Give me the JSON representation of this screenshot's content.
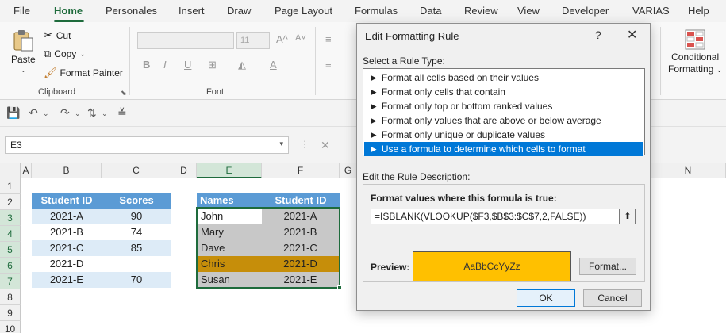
{
  "tabs": [
    "File",
    "Home",
    "Personales",
    "Insert",
    "Draw",
    "Page Layout",
    "Formulas",
    "Data",
    "Review",
    "View",
    "Developer",
    "VARIAS",
    "Help"
  ],
  "ribbon": {
    "paste": "Paste",
    "cut": "Cut",
    "copy": "Copy",
    "format_painter": "Format Painter",
    "clipboard": "Clipboard",
    "font_size": "11",
    "font": "Font",
    "bold": "B",
    "italic": "I",
    "underline": "U",
    "cond_format_1": "Conditional",
    "cond_format_2": "Formatting"
  },
  "formula_bar": {
    "name_box": "E3"
  },
  "columns": [
    "A",
    "B",
    "C",
    "D",
    "E",
    "F",
    "G",
    "N"
  ],
  "rows": [
    "1",
    "2",
    "3",
    "4",
    "5",
    "6",
    "7",
    "8",
    "9",
    "10"
  ],
  "table1": {
    "headers": [
      "Student ID",
      "Scores"
    ],
    "rows": [
      [
        "2021-A",
        "90"
      ],
      [
        "2021-B",
        "74"
      ],
      [
        "2021-C",
        "85"
      ],
      [
        "2021-D",
        ""
      ],
      [
        "2021-E",
        "70"
      ]
    ]
  },
  "table2": {
    "headers": [
      "Names",
      "Student ID"
    ],
    "rows": [
      [
        "John",
        "2021-A"
      ],
      [
        "Mary",
        "2021-B"
      ],
      [
        "Dave",
        "2021-C"
      ],
      [
        "Chris",
        "2021-D"
      ],
      [
        "Susan",
        "2021-E"
      ]
    ]
  },
  "dialog": {
    "title": "Edit Formatting Rule",
    "help": "?",
    "close": "✕",
    "select_rule_type": "Select a Rule Type:",
    "rules": [
      "Format all cells based on their values",
      "Format only cells that contain",
      "Format only top or bottom ranked values",
      "Format only values that are above or below average",
      "Format only unique or duplicate values",
      "Use a formula to determine which cells to format"
    ],
    "selected_rule": 5,
    "edit_description": "Edit the Rule Description:",
    "formula_label": "Format values where this formula is true:",
    "formula": "=ISBLANK(VLOOKUP($F3,$B$3:$C$7,2,FALSE))",
    "preview_label": "Preview:",
    "preview_text": "AaBbCcYyZz",
    "format_button": "Format...",
    "ok": "OK",
    "cancel": "Cancel"
  },
  "colors": {
    "accent": "#1e6b3c",
    "header": "#5b9bd5",
    "band": "#ddebf7",
    "preview": "#ffc000",
    "highlight": "#c68e0a"
  }
}
